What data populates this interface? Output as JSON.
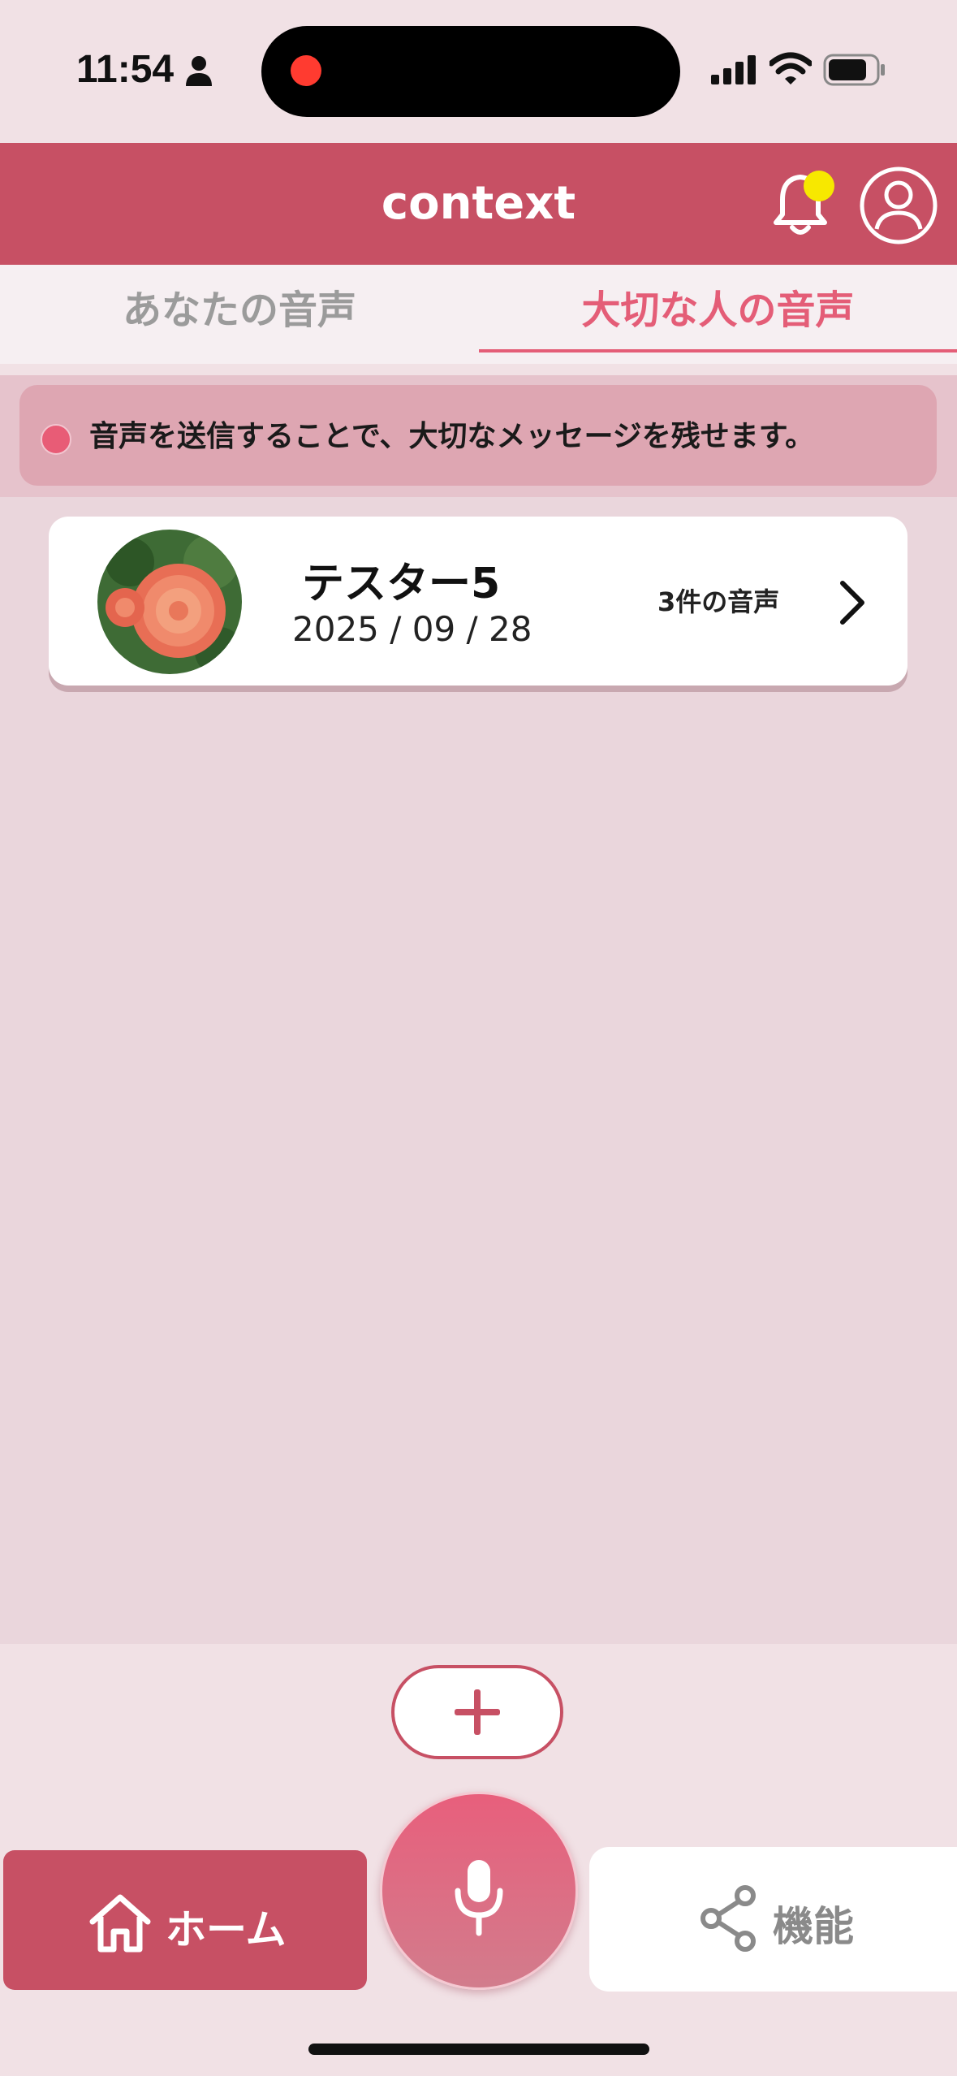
{
  "status_bar": {
    "time": "11:54",
    "icons": [
      "person-icon",
      "signal-icon",
      "wifi-icon",
      "battery-icon"
    ]
  },
  "header": {
    "title": "context",
    "icons": [
      "bell-icon",
      "profile-icon"
    ],
    "notification_dot_color": "#f7e800"
  },
  "tabs": [
    {
      "label": "あなたの音声",
      "active": false
    },
    {
      "label": "大切な人の音声",
      "active": true
    }
  ],
  "banner": {
    "text": "音声を送信することで、大切なメッセージを残せます。"
  },
  "cards": [
    {
      "name": "テスター5",
      "date": "2025 / 09 / 28",
      "count": "3件の音声"
    }
  ],
  "bottom_nav": {
    "home_label": "ホーム",
    "features_label": "機能"
  },
  "colors": {
    "accent": "#c75064",
    "tab_active": "#e45d77",
    "background": "#ead6dc"
  }
}
